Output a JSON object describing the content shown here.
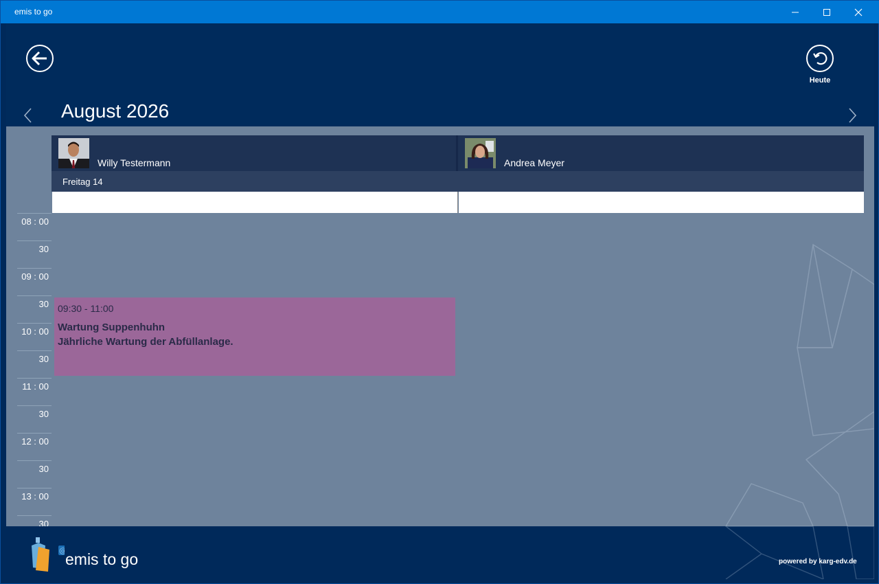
{
  "window": {
    "title": "emis to go"
  },
  "header": {
    "today_label": "Heute",
    "month_title": "August 2026"
  },
  "resources": [
    {
      "name": "Willy Testermann"
    },
    {
      "name": "Andrea Meyer"
    }
  ],
  "day": {
    "label": "Freitag 14"
  },
  "time_slots": [
    "08 : 00",
    "30",
    "09 : 00",
    "30",
    "10 : 00",
    "30",
    "11 : 00",
    "30",
    "12 : 00",
    "30",
    "13 : 00",
    "30"
  ],
  "appointment": {
    "time": "09:30 - 11:00",
    "title": "Wartung Suppenhuhn",
    "description": "Jährliche Wartung der Abfüllanlage."
  },
  "footer": {
    "logo_text": "emis to go",
    "powered": "powered by karg-edv.de"
  },
  "colors": {
    "titlebar": "#0078d4",
    "header": "#002b5c",
    "content": "#6e839c",
    "appointment": "#9b6799"
  }
}
